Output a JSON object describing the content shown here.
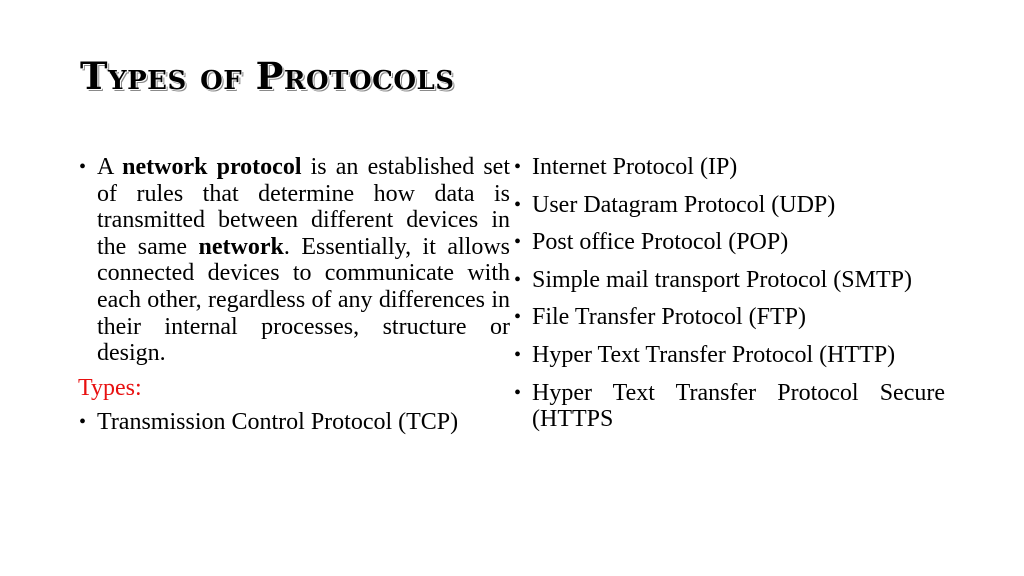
{
  "slide": {
    "title": "Types of Protocols",
    "intro": {
      "prefix": "A ",
      "bold1": "network protocol",
      "middle": " is an established set of rules that determine how data is transmitted between different devices in the same ",
      "bold2": "network",
      "suffix": ". Essentially, it allows connected devices to communicate with each other, regardless of any differences in their internal processes, structure or design."
    },
    "types_label": "Types:",
    "types_label_color": "#e81010",
    "left_items": [
      "Transmission Control Protocol (TCP)"
    ],
    "right_items": [
      "Internet Protocol (IP)",
      "User Datagram Protocol (UDP)",
      "Post office Protocol (POP)",
      "Simple mail transport Protocol (SMTP)",
      "File Transfer Protocol (FTP)",
      "Hyper Text Transfer Protocol (HTTP)",
      "Hyper Text Transfer Protocol Secure (HTTPS"
    ],
    "bullet_glyph": "•"
  }
}
